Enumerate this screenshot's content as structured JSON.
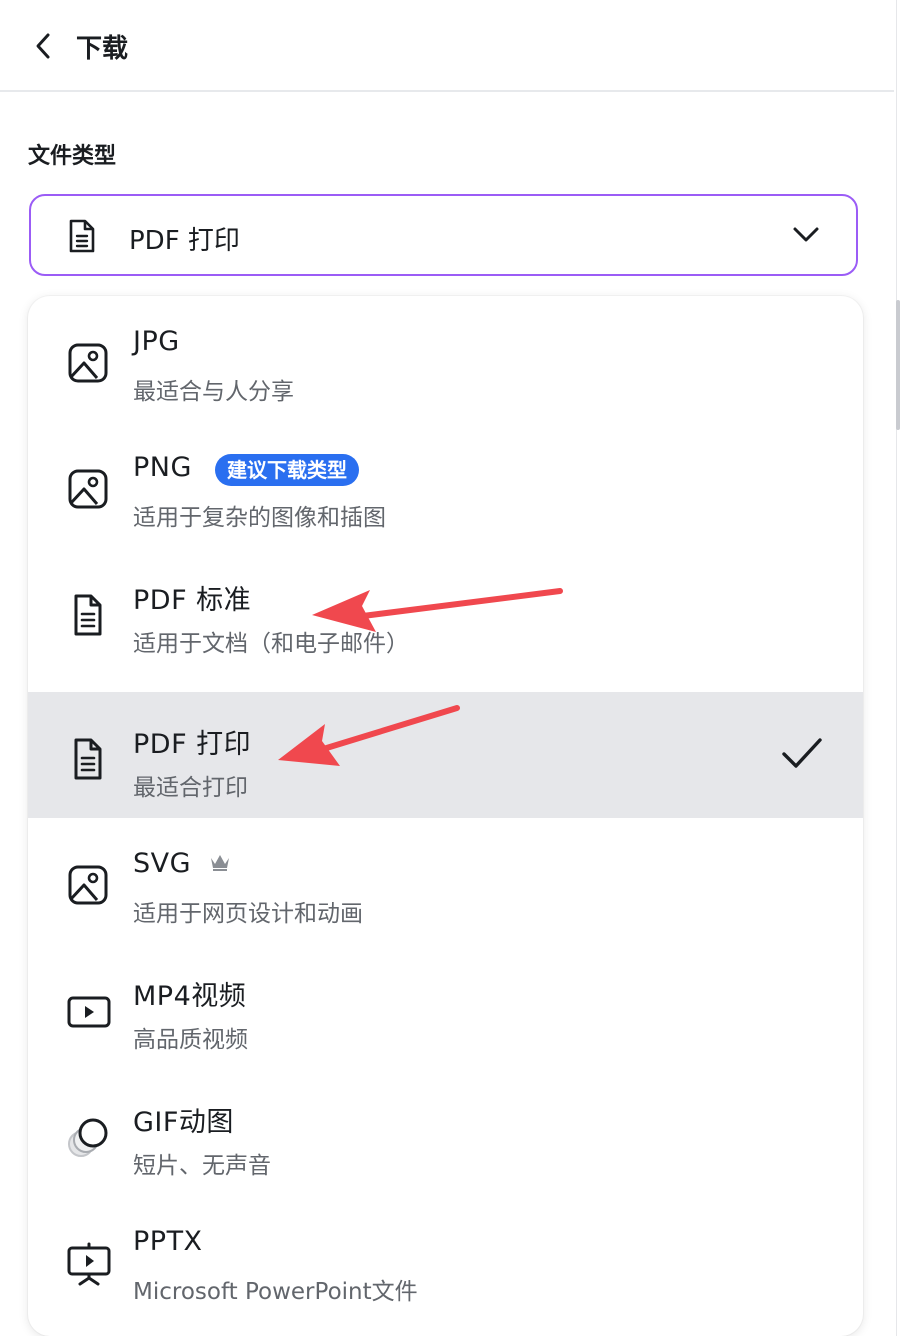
{
  "header": {
    "title": "下载",
    "back_icon": "chevron-left-icon"
  },
  "file_type": {
    "label": "文件类型",
    "selected_value": "PDF 打印",
    "selected_icon": "document-icon"
  },
  "options": [
    {
      "name": "JPG",
      "description": "最适合与人分享",
      "icon": "image-icon"
    },
    {
      "name": "PNG",
      "description": "适用于复杂的图像和插图",
      "icon": "image-icon",
      "badge": "建议下载类型"
    },
    {
      "name": "PDF 标准",
      "description": "适用于文档（和电子邮件）",
      "icon": "document-icon"
    },
    {
      "name": "PDF 打印",
      "description": "最适合打印",
      "icon": "document-icon",
      "selected": true
    },
    {
      "name": "SVG",
      "description": "适用于网页设计和动画",
      "icon": "image-icon",
      "premium_icon": "crown-icon"
    },
    {
      "name": "MP4视频",
      "description": "高品质视频",
      "icon": "video-icon"
    },
    {
      "name": "GIF动图",
      "description": "短片、无声音",
      "icon": "gif-icon"
    },
    {
      "name": "PPTX",
      "description": "Microsoft PowerPoint文件",
      "icon": "presentation-icon"
    }
  ],
  "colors": {
    "select_border": "#9b5cf6",
    "badge_bg": "#2a6ff0",
    "selected_row_bg": "#e6e7ea",
    "annotation_arrow": "#f0484e"
  }
}
